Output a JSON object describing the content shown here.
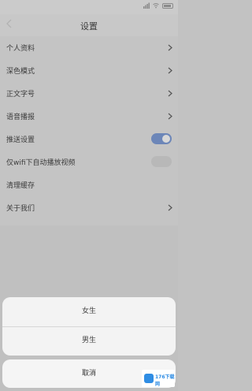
{
  "status_bar": {
    "left_text": "",
    "battery_icon": "battery-icon",
    "wifi_icon": "wifi-icon",
    "signal_icon": "signal-icon"
  },
  "header": {
    "title": "设置",
    "back_icon": "back-arrow-icon"
  },
  "settings": [
    {
      "label": "个人资料",
      "value": "",
      "control": "chevron"
    },
    {
      "label": "深色模式",
      "value": "",
      "control": "chevron"
    },
    {
      "label": "正文字号",
      "value": "",
      "control": "chevron"
    },
    {
      "label": "语音播报",
      "value": "",
      "control": "chevron"
    },
    {
      "label": "推送设置",
      "value": "",
      "control": "toggle-on"
    },
    {
      "label": "仅wifi下自动播放视频",
      "value": "",
      "control": "toggle-off"
    },
    {
      "label": "清理缓存",
      "value": "",
      "control": "none"
    },
    {
      "label": "关于我们",
      "value": "",
      "control": "chevron"
    }
  ],
  "action_sheet": {
    "options": [
      "女生",
      "男生"
    ],
    "cancel_label": "取消"
  },
  "watermark": {
    "text": "176下载网",
    "sub": ""
  },
  "colors": {
    "toggle_on": "#6c86b8",
    "sheet_bg": "#f3f3f3",
    "dim_bg": "#c2c2c2"
  }
}
